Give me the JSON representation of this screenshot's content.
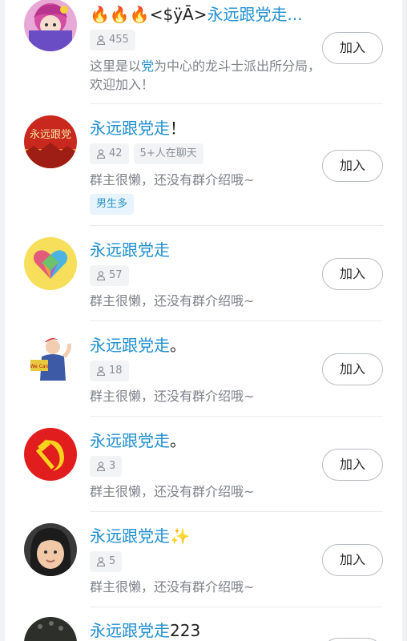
{
  "colors": {
    "highlight": "#1f8fcf",
    "muted": "#7d8189",
    "tag_bg": "#e7f4fb"
  },
  "join_label": "加入",
  "groups": [
    {
      "title_prefix": "🔥🔥🔥<$ÿĀ>",
      "title_hl": "永远跟党走...",
      "title_suffix": "",
      "members": "455",
      "active": "",
      "desc_a": "这里是以",
      "desc_hl": "党",
      "desc_b": "为中心的龙斗士派出所分局，欢迎加入！",
      "tag": "",
      "avatar_icon": "anime-girl-avatar"
    },
    {
      "title_prefix": "",
      "title_hl": "永远跟党走",
      "title_suffix": "！",
      "members": "42",
      "active": "5+人在聊天",
      "desc_a": "群主很懒，还没有群介绍哦~",
      "desc_hl": "",
      "desc_b": "",
      "tag": "男生多",
      "avatar_icon": "red-banner-avatar"
    },
    {
      "title_prefix": "",
      "title_hl": "永远跟党走",
      "title_suffix": "",
      "members": "57",
      "active": "",
      "desc_a": "群主很懒，还没有群介绍哦~",
      "desc_hl": "",
      "desc_b": "",
      "tag": "",
      "avatar_icon": "colorful-heart-avatar"
    },
    {
      "title_prefix": "",
      "title_hl": "永远跟党走",
      "title_suffix": "。",
      "members": "18",
      "active": "",
      "desc_a": "群主很懒，还没有群介绍哦~",
      "desc_hl": "",
      "desc_b": "",
      "tag": "",
      "avatar_icon": "we-can-do-it-avatar"
    },
    {
      "title_prefix": "",
      "title_hl": "永远跟党走",
      "title_suffix": "。",
      "members": "3",
      "active": "",
      "desc_a": "群主很懒，还没有群介绍哦~",
      "desc_hl": "",
      "desc_b": "",
      "tag": "",
      "avatar_icon": "hammer-sickle-avatar"
    },
    {
      "title_prefix": "",
      "title_hl": "永远跟党走",
      "title_suffix": "✨",
      "members": "5",
      "active": "",
      "desc_a": "群主很懒，还没有群介绍哦~",
      "desc_hl": "",
      "desc_b": "",
      "tag": "",
      "avatar_icon": "child-photo-avatar"
    },
    {
      "title_prefix": "",
      "title_hl": "永远跟党走",
      "title_suffix": "223",
      "members": "",
      "active": "",
      "desc_a": "",
      "desc_hl": "",
      "desc_b": "",
      "tag": "",
      "avatar_icon": "dark-photo-avatar"
    }
  ]
}
